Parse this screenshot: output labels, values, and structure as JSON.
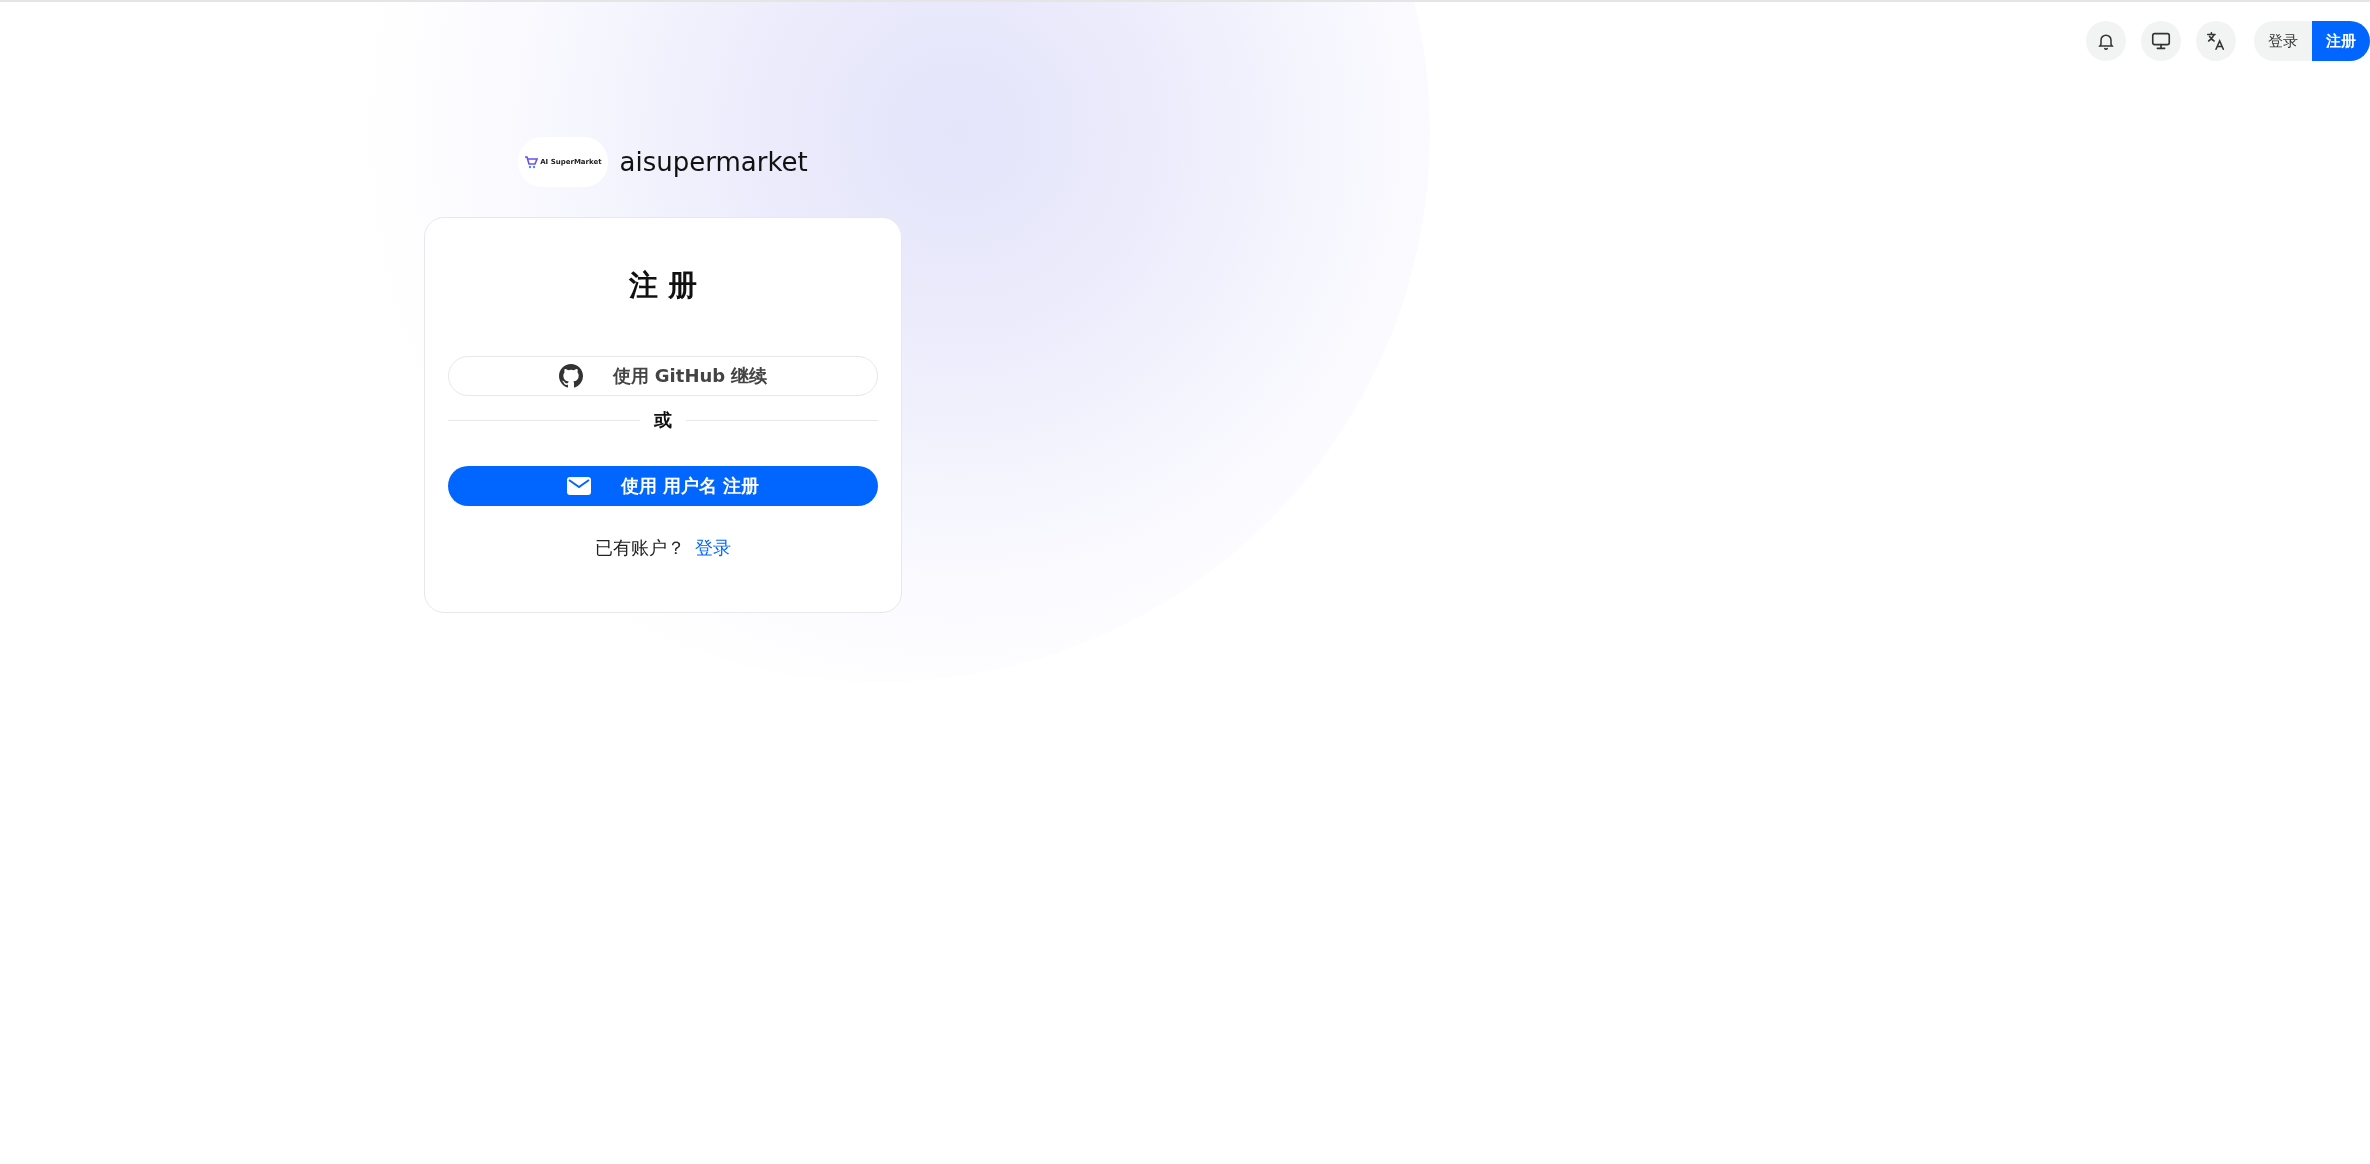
{
  "header": {
    "icon_buttons": [
      {
        "kind": "bell"
      },
      {
        "kind": "monitor"
      },
      {
        "kind": "translate"
      }
    ],
    "auth_buttons": [
      {
        "label": "登录",
        "kind": "secondary"
      },
      {
        "label": "注册",
        "kind": "primary"
      }
    ]
  },
  "brand": {
    "logo_text": "AI SuperMarket",
    "name": "aisupermarket"
  },
  "card": {
    "title": "注 册",
    "buttons": [
      {
        "label": "使用 GitHub 继续",
        "kind": "github"
      }
    ],
    "divider": "或",
    "primary_buttons": [
      {
        "label": "使用 用户名 注册",
        "kind": "email"
      }
    ],
    "footer": {
      "text": "已有账户？",
      "link": "登录"
    }
  }
}
